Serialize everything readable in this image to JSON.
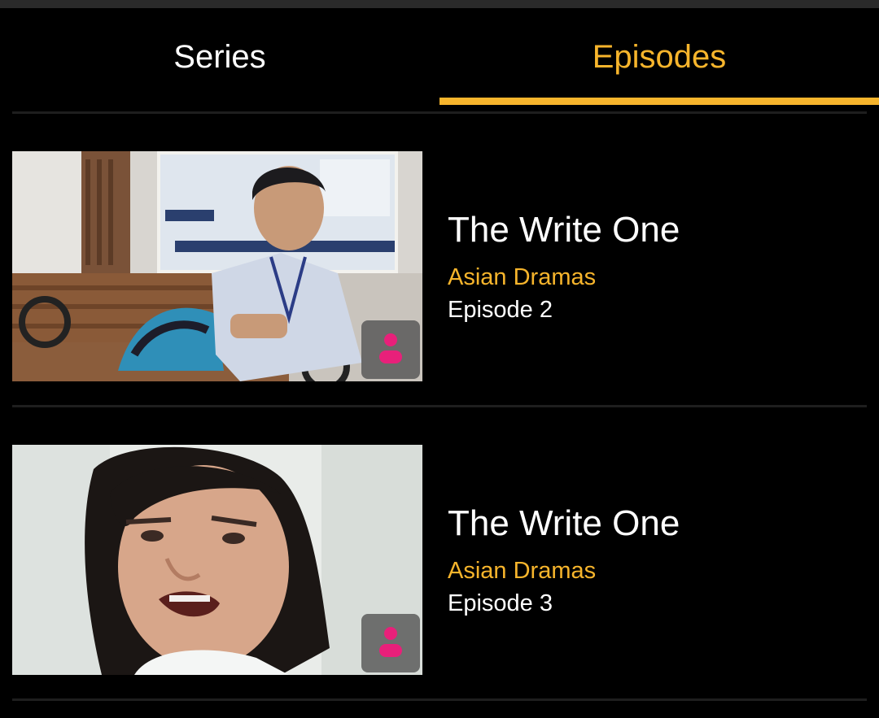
{
  "tabs": [
    {
      "label": "Series",
      "active": false
    },
    {
      "label": "Episodes",
      "active": true
    }
  ],
  "colors": {
    "accent": "#f7b52c",
    "badge_icon": "#e8207a",
    "background": "#000000"
  },
  "episodes": [
    {
      "title": "The Write One",
      "category": "Asian Dramas",
      "episode": "Episode 2",
      "thumbnail": "schoolboy-on-bench",
      "badge_icon": "user-icon"
    },
    {
      "title": "The Write One",
      "category": "Asian Dramas",
      "episode": "Episode 3",
      "thumbnail": "surprised-man-closeup",
      "badge_icon": "user-icon"
    }
  ]
}
